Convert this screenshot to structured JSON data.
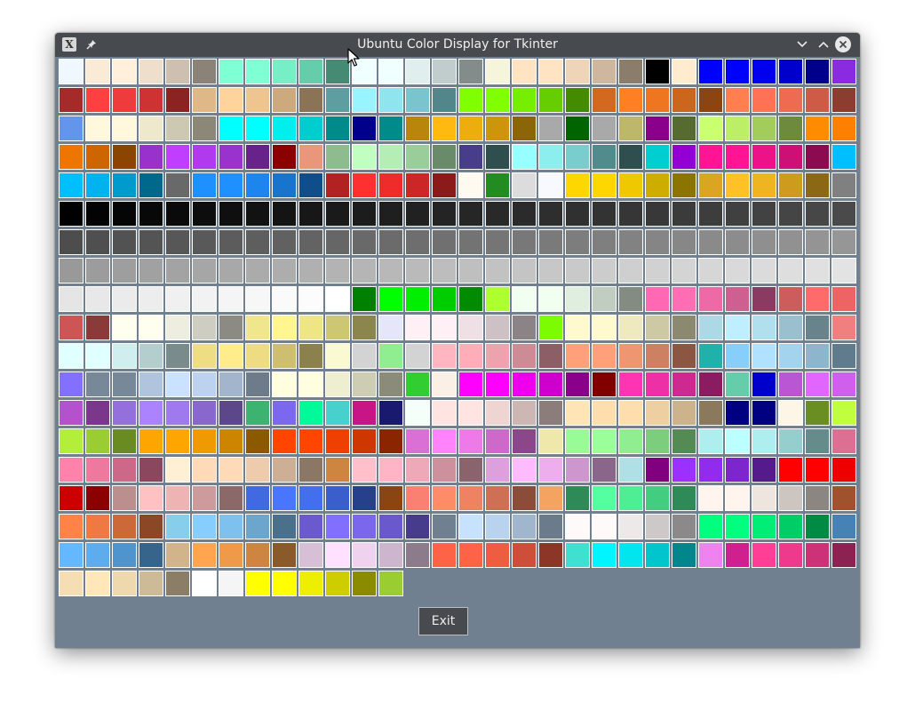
{
  "window": {
    "title": "Ubuntu Color Display for Tkinter",
    "app_icon_glyph": "X",
    "controls": [
      "minimize",
      "maximize",
      "close"
    ]
  },
  "exit_label": "Exit",
  "colors": {
    "titlebar": "#474a4e",
    "background": "#708090",
    "swatch_border": "#ffffff"
  },
  "icons": {
    "app": "x-app-icon",
    "pin": "pin-icon",
    "minimize": "chevron-down-icon",
    "maximize": "chevron-up-icon",
    "close": "close-icon"
  },
  "swatches": [
    "#f0f8ff",
    "#faebd7",
    "#ffefdb",
    "#eedfcc",
    "#cdc0b0",
    "#8b8378",
    "#7fffd4",
    "#7fffd4",
    "#76eec6",
    "#66cdaa",
    "#458b74",
    "#f0ffff",
    "#f0ffff",
    "#e0eeee",
    "#c1cdcd",
    "#838b8b",
    "#f5f5dc",
    "#ffe4c4",
    "#ffe4c4",
    "#eed5b7",
    "#cdb79e",
    "#8b7d6b",
    "#000000",
    "#ffebcd",
    "#0000ff",
    "#0000ff",
    "#0000ee",
    "#0000cd",
    "#00008b",
    "#8a2be2",
    "#a52a2a",
    "#ff4040",
    "#ee3b3b",
    "#cd3333",
    "#8b2323",
    "#deb887",
    "#ffd39b",
    "#eec591",
    "#cdaa7d",
    "#8b7355",
    "#5f9ea0",
    "#98f5ff",
    "#8ee5ee",
    "#7ac5cd",
    "#53868b",
    "#7fff00",
    "#7fff00",
    "#76ee00",
    "#66cd00",
    "#458b00",
    "#d2691e",
    "#ff7f24",
    "#ee7621",
    "#cd661d",
    "#8b4513",
    "#ff7f50",
    "#ff7256",
    "#ee6a50",
    "#cd5b45",
    "#8b3e2f",
    "#6495ed",
    "#fff8dc",
    "#fff8dc",
    "#eee8cd",
    "#cdc8b1",
    "#8b8878",
    "#00ffff",
    "#00ffff",
    "#00eeee",
    "#00cdcd",
    "#008b8b",
    "#00008b",
    "#008b8b",
    "#b8860b",
    "#ffb90f",
    "#eead0e",
    "#cd950c",
    "#8b6508",
    "#a9a9a9",
    "#006400",
    "#a9a9a9",
    "#bdb76b",
    "#8b008b",
    "#556b2f",
    "#caff70",
    "#bcee68",
    "#a2cd5a",
    "#6e8b3d",
    "#ff8c00",
    "#ff7f00",
    "#ee7600",
    "#cd6600",
    "#8b4500",
    "#9932cc",
    "#bf3eff",
    "#b23aee",
    "#9a32cd",
    "#68228b",
    "#8b0000",
    "#e9967a",
    "#8fbc8f",
    "#c1ffc1",
    "#b4eeb4",
    "#9bcd9b",
    "#698b69",
    "#483d8b",
    "#2f4f4f",
    "#97ffff",
    "#8deeee",
    "#79cdcd",
    "#528b8b",
    "#2f4f4f",
    "#00ced1",
    "#9400d3",
    "#ff1493",
    "#ff1493",
    "#ee1289",
    "#cd1076",
    "#8b0a50",
    "#00bfff",
    "#00bfff",
    "#00b2ee",
    "#009acd",
    "#00688b",
    "#696969",
    "#1e90ff",
    "#1e90ff",
    "#1c86ee",
    "#1874cd",
    "#104e8b",
    "#b22222",
    "#ff3030",
    "#ee2c2c",
    "#cd2626",
    "#8b1a1a",
    "#fffaf0",
    "#228b22",
    "#dcdcdc",
    "#f8f8ff",
    "#ffd700",
    "#ffd700",
    "#eec900",
    "#cdad00",
    "#8b7500",
    "#daa520",
    "#ffc125",
    "#eeb422",
    "#cd9b1d",
    "#8b6914",
    "#808080",
    "#000000",
    "#030303",
    "#050505",
    "#080808",
    "#0a0a0a",
    "#0d0d0d",
    "#0f0f0f",
    "#121212",
    "#141414",
    "#171717",
    "#1a1a1a",
    "#1c1c1c",
    "#1f1f1f",
    "#212121",
    "#242424",
    "#262626",
    "#292929",
    "#2b2b2b",
    "#2e2e2e",
    "#303030",
    "#333333",
    "#363636",
    "#383838",
    "#3b3b3b",
    "#3d3d3d",
    "#404040",
    "#424242",
    "#454545",
    "#474747",
    "#4a4a4a",
    "#4d4d4d",
    "#4f4f4f",
    "#525252",
    "#545454",
    "#575757",
    "#595959",
    "#5c5c5c",
    "#5e5e5e",
    "#616161",
    "#636363",
    "#666666",
    "#696969",
    "#6b6b6b",
    "#6e6e6e",
    "#707070",
    "#737373",
    "#757575",
    "#787878",
    "#7a7a7a",
    "#7d7d7d",
    "#7f7f7f",
    "#828282",
    "#858585",
    "#878787",
    "#8a8a8a",
    "#8c8c8c",
    "#8f8f8f",
    "#919191",
    "#949494",
    "#969696",
    "#999999",
    "#9c9c9c",
    "#9e9e9e",
    "#a1a1a1",
    "#a3a3a3",
    "#a6a6a6",
    "#a8a8a8",
    "#ababab",
    "#adadad",
    "#b0b0b0",
    "#b3b3b3",
    "#b5b5b5",
    "#b8b8b8",
    "#bababa",
    "#bdbdbd",
    "#bfbfbf",
    "#c2c2c2",
    "#c4c4c4",
    "#c7c7c7",
    "#c9c9c9",
    "#cccccc",
    "#cfcfcf",
    "#d1d1d1",
    "#d4d4d4",
    "#d6d6d6",
    "#d9d9d9",
    "#dbdbdb",
    "#dedede",
    "#e0e0e0",
    "#e3e3e3",
    "#e5e5e5",
    "#e8e8e8",
    "#ebebeb",
    "#ededed",
    "#f0f0f0",
    "#f2f2f2",
    "#f5f5f5",
    "#f7f7f7",
    "#fafafa",
    "#fcfcfc",
    "#ffffff",
    "#008000",
    "#00ff00",
    "#00ee00",
    "#00cd00",
    "#008b00",
    "#adff2f",
    "#f0fff0",
    "#f0fff0",
    "#e0eee0",
    "#c1cdc1",
    "#838b83",
    "#ff69b4",
    "#ff6eb4",
    "#ee6aa7",
    "#cd6090",
    "#8b3a62",
    "#cd5c5c",
    "#ff6a6a",
    "#ee6363",
    "#cd5555",
    "#8b3a3a",
    "#fffff0",
    "#fffff0",
    "#eeeee0",
    "#cdcdc1",
    "#8b8b83",
    "#f0e68c",
    "#fff68f",
    "#eee685",
    "#cdc673",
    "#8b864e",
    "#e6e6fa",
    "#fff0f5",
    "#fff0f5",
    "#eee0e5",
    "#cdc1c5",
    "#8b8386",
    "#7cfc00",
    "#fffacd",
    "#fffacd",
    "#eee9bf",
    "#cdc9a5",
    "#8b8970",
    "#add8e6",
    "#bfefff",
    "#b2dfee",
    "#9ac0cd",
    "#68838b",
    "#f08080",
    "#e0ffff",
    "#e0ffff",
    "#d1eeee",
    "#b4cdcd",
    "#7a8b8b",
    "#eedd82",
    "#ffec8b",
    "#eedc82",
    "#cdbe70",
    "#8b814c",
    "#fafad2",
    "#d3d3d3",
    "#90ee90",
    "#d3d3d3",
    "#ffb6c1",
    "#ffaeb9",
    "#eea2ad",
    "#cd8c95",
    "#8b5f65",
    "#ffa07a",
    "#ffa07a",
    "#ee9572",
    "#cd8162",
    "#8b5742",
    "#20b2aa",
    "#87cefa",
    "#b0e2ff",
    "#a4d3ee",
    "#8db6cd",
    "#607b8b",
    "#8470ff",
    "#778899",
    "#778899",
    "#b0c4de",
    "#cae1ff",
    "#bcd2ee",
    "#a2b5cd",
    "#6e7b8b",
    "#ffffe0",
    "#ffffe0",
    "#eeeed1",
    "#cdcdb4",
    "#8b8b7a",
    "#32cd32",
    "#faf0e6",
    "#ff00ff",
    "#ff00ff",
    "#ee00ee",
    "#cd00cd",
    "#8b008b",
    "#800000",
    "#ff34b3",
    "#ee30a7",
    "#cd2990",
    "#8b1c62",
    "#66cdaa",
    "#0000cd",
    "#ba55d3",
    "#e066ff",
    "#d15fee",
    "#b452cd",
    "#7a378b",
    "#9370db",
    "#ab82ff",
    "#9f79ee",
    "#8968cd",
    "#5d478b",
    "#3cb371",
    "#7b68ee",
    "#00fa9a",
    "#48d1cc",
    "#c71585",
    "#191970",
    "#f5fffa",
    "#ffe4e1",
    "#ffe4e1",
    "#eed5d2",
    "#cdb7b5",
    "#8b7d7b",
    "#ffe4b5",
    "#ffdead",
    "#ffdead",
    "#eecfa1",
    "#cdb38b",
    "#8b795e",
    "#000080",
    "#000080",
    "#fdf5e6",
    "#6b8e23",
    "#c0ff3e",
    "#b3ee3a",
    "#9acd32",
    "#698b22",
    "#ffa500",
    "#ffa500",
    "#ee9a00",
    "#cd8500",
    "#8b5a00",
    "#ff4500",
    "#ff4500",
    "#ee4000",
    "#cd3700",
    "#8b2500",
    "#da70d6",
    "#ff83fa",
    "#ee7ae9",
    "#cd69c9",
    "#8b4789",
    "#eee8aa",
    "#98fb98",
    "#9aff9a",
    "#90ee90",
    "#7ccd7c",
    "#548b54",
    "#afeeee",
    "#bbffff",
    "#aeeeee",
    "#96cdcd",
    "#668b8b",
    "#db7093",
    "#ff82ab",
    "#ee799f",
    "#cd6889",
    "#8b475d",
    "#ffefd5",
    "#ffdab9",
    "#ffdab9",
    "#eecbad",
    "#cdaf95",
    "#8b7765",
    "#cd853f",
    "#ffc0cb",
    "#ffb5c5",
    "#eea9b8",
    "#cd919e",
    "#8b636c",
    "#dda0dd",
    "#ffbbff",
    "#eeaeee",
    "#cd96cd",
    "#8b668b",
    "#b0e0e6",
    "#800080",
    "#9b30ff",
    "#912cee",
    "#7d26cd",
    "#551a8b",
    "#ff0000",
    "#ff0000",
    "#ee0000",
    "#cd0000",
    "#8b0000",
    "#bc8f8f",
    "#ffc1c1",
    "#eeb4b4",
    "#cd9b9b",
    "#8b6969",
    "#4169e1",
    "#4876ff",
    "#436eee",
    "#3a5fcd",
    "#27408b",
    "#8b4513",
    "#fa8072",
    "#ff8c69",
    "#ee8262",
    "#cd7054",
    "#8b4c39",
    "#f4a460",
    "#2e8b57",
    "#54ff9f",
    "#4eee94",
    "#43cd80",
    "#2e8b57",
    "#fff5ee",
    "#fff5ee",
    "#eee5de",
    "#cdc5bf",
    "#8b8682",
    "#a0522d",
    "#ff8247",
    "#ee7942",
    "#cd6839",
    "#8b4726",
    "#87ceeb",
    "#87ceff",
    "#7ec0ee",
    "#6ca6cd",
    "#4a708b",
    "#6a5acd",
    "#836fff",
    "#7a67ee",
    "#6959cd",
    "#473c8b",
    "#708090",
    "#c6e2ff",
    "#b9d3ee",
    "#9fb6cd",
    "#6c7b8b",
    "#fffafa",
    "#fffafa",
    "#eee9e9",
    "#cdc9c9",
    "#8b8989",
    "#00ff7f",
    "#00ff7f",
    "#00ee76",
    "#00cd66",
    "#008b45",
    "#4682b4",
    "#63b8ff",
    "#5cacee",
    "#4f94cd",
    "#36648b",
    "#d2b48c",
    "#ffa54f",
    "#ee9a49",
    "#cd853f",
    "#8b5a2b",
    "#d8bfd8",
    "#ffe1ff",
    "#eed2ee",
    "#cdb5cd",
    "#8b7b8b",
    "#ff6347",
    "#ff6347",
    "#ee5c42",
    "#cd4f39",
    "#8b3626",
    "#40e0d0",
    "#00f5ff",
    "#00e5ee",
    "#00c5cd",
    "#00868b",
    "#ee82ee",
    "#d02090",
    "#ff3e96",
    "#ee3a8c",
    "#cd3278",
    "#8b2252",
    "#f5deb3",
    "#ffe7ba",
    "#eed8ae",
    "#cdba96",
    "#8b7e66",
    "#ffffff",
    "#f5f5f5",
    "#ffff00",
    "#ffff00",
    "#eeee00",
    "#cdcd00",
    "#8b8b00",
    "#9acd32"
  ]
}
